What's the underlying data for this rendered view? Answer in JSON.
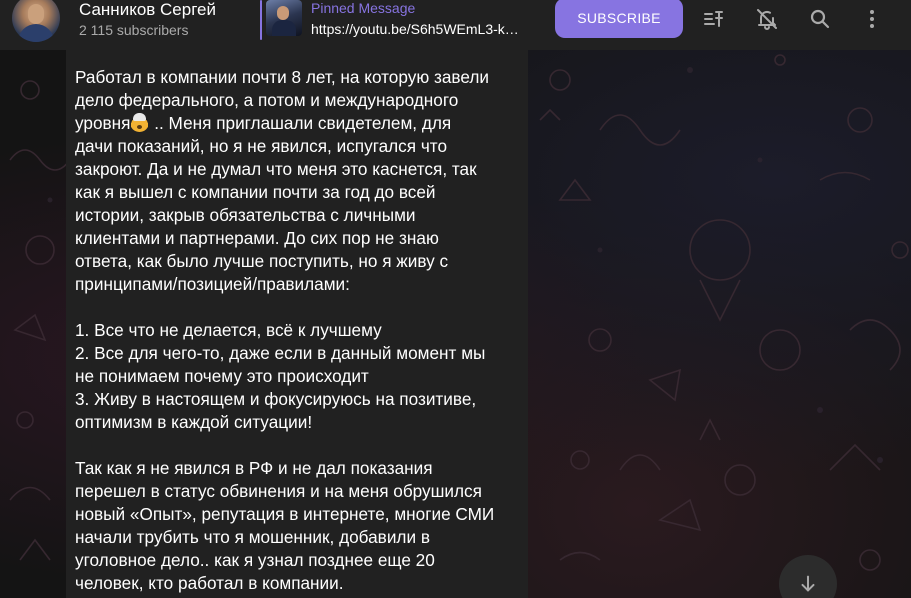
{
  "header": {
    "channel_name": "Санников Сергей",
    "subscribers": "2 115 subscribers",
    "avatar_icon": "channel-avatar",
    "pinned": {
      "title": "Pinned Message",
      "text": "https://youtu.be/S6h5WEmL3-k…"
    },
    "subscribe_label": "SUBSCRIBE",
    "actions": [
      {
        "name": "pinned-list-icon"
      },
      {
        "name": "mute-bell-icon"
      },
      {
        "name": "search-icon"
      },
      {
        "name": "more-vertical-icon"
      }
    ]
  },
  "message": {
    "lines_p1": [
      "Работал в компании почти 8 лет, на которую завели",
      "дело федерального, а потом и международного",
      "уровня",
      "дачи показаний, но я не явился, испугался что",
      "закроют. Да и не думал что меня это каснется, так",
      "как я вышел с компании почти за год до всей",
      "истории, закрыв обязательства с личными",
      "клиентами и партнерами. До сих пор не знаю",
      "ответа, как было лучше поступить, но я живу с",
      "принципами/позицией/правилами:"
    ],
    "line3_tail": " .. Меня приглашали свидетелем, для",
    "emoji": "exploding-head-emoji",
    "list": [
      "1. Все что не делается, всё к лучшему",
      "2. Все для чего-то, даже если в данный момент мы",
      "не понимаем почему это происходит",
      "3. Живу в настоящем и фокусируюсь на позитиве,",
      "оптимизм в каждой ситуации!"
    ],
    "lines_p3": [
      "Так как я не явился в РФ и не дал показания",
      "перешел в статус обвинения и на меня обрушился",
      "новый «Опыт», репутация в интернете, многие СМИ",
      "начали трубить что я мошенник, добавили в",
      "уголовное дело.. как я узнал позднее еще 20",
      "человек, кто работал в компании."
    ]
  },
  "scroll_down_icon": "arrow-down-icon",
  "colors": {
    "accent": "#8774e1",
    "bar": "#212121",
    "bubble": "#212121",
    "background": "#141414"
  }
}
